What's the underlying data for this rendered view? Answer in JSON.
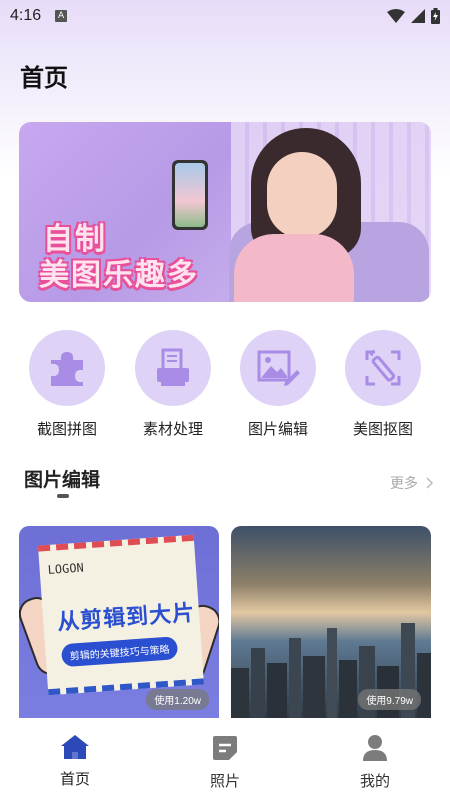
{
  "status_bar": {
    "time": "4:16",
    "indicator": "A"
  },
  "header": {
    "title": "首页"
  },
  "banner": {
    "line1": "自制",
    "line2": "美图乐趣多"
  },
  "features": [
    {
      "label": "截图拼图",
      "icon": "puzzle-icon"
    },
    {
      "label": "素材处理",
      "icon": "printer-icon"
    },
    {
      "label": "图片编辑",
      "icon": "image-edit-icon"
    },
    {
      "label": "美图抠图",
      "icon": "magic-crop-icon"
    }
  ],
  "section": {
    "title": "图片编辑",
    "more_label": "更多"
  },
  "cards": [
    {
      "title": "从剪辑到大片",
      "subtitle": "剪辑的关键技巧与策略",
      "usage": "使用1.20w",
      "scribble": "LOGON"
    },
    {
      "usage": "使用9.79w"
    }
  ],
  "bottom_nav": [
    {
      "label": "首页",
      "icon": "home-icon",
      "active": true
    },
    {
      "label": "照片",
      "icon": "photo-icon",
      "active": false
    },
    {
      "label": "我的",
      "icon": "user-icon",
      "active": false
    }
  ],
  "colors": {
    "accent": "#2c49b8",
    "feature_bg": "#ded3f6",
    "feature_icon": "#a98ce6",
    "banner_text_stroke": "#e8509a"
  }
}
